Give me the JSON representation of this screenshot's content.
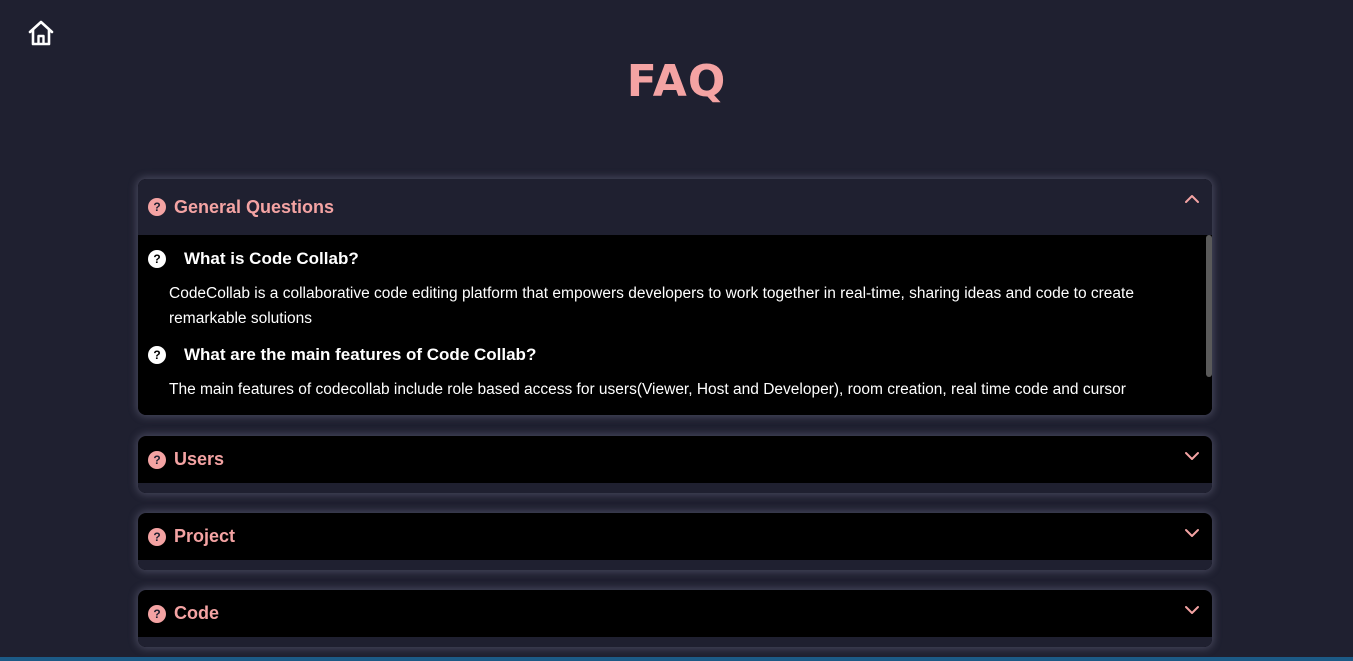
{
  "page": {
    "title": "FAQ",
    "home_icon": "home-icon"
  },
  "colors": {
    "background": "#1f2030",
    "accent": "#f4a3a3",
    "panel": "#000000",
    "text": "#ffffff"
  },
  "sections": [
    {
      "label": "General Questions",
      "expanded": true,
      "icon": "question-circle-icon",
      "chevron": "chevron-up-icon",
      "items": [
        {
          "question": "What is Code Collab?",
          "answer": "CodeCollab is a collaborative code editing platform that empowers developers to work together in real-time, sharing ideas and code to create remarkable solutions"
        },
        {
          "question": "What are the main features of Code Collab?",
          "answer": "The main features of codecollab include role based access for users(Viewer, Host and Developer), room creation, real time code and cursor"
        }
      ]
    },
    {
      "label": "Users",
      "expanded": false,
      "icon": "question-circle-icon",
      "chevron": "chevron-down-icon"
    },
    {
      "label": "Project",
      "expanded": false,
      "icon": "question-circle-icon",
      "chevron": "chevron-down-icon"
    },
    {
      "label": "Code",
      "expanded": false,
      "icon": "question-circle-icon",
      "chevron": "chevron-down-icon"
    }
  ]
}
